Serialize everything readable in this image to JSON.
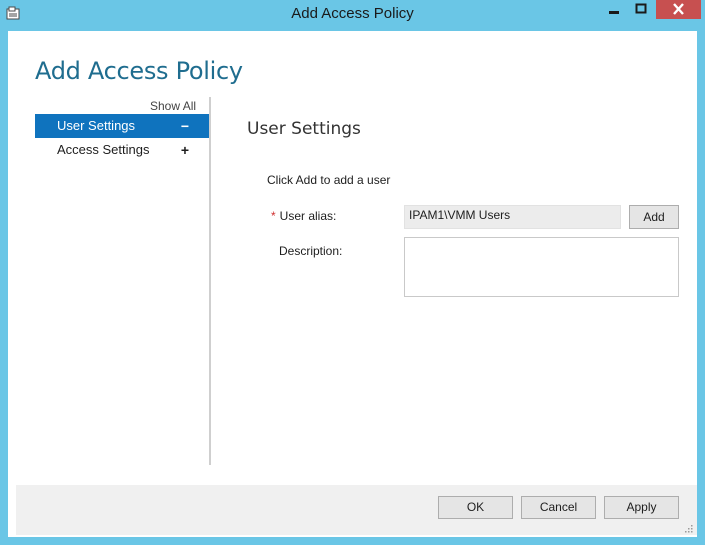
{
  "window": {
    "title": "Add Access Policy",
    "colors": {
      "frame": "#6ac6e6",
      "close": "#c75050",
      "accent": "#0f73be"
    }
  },
  "dialog": {
    "heading": "Add Access Policy"
  },
  "nav": {
    "show_all": "Show All",
    "items": [
      {
        "label": "User Settings",
        "sign": "−",
        "active": true
      },
      {
        "label": "Access Settings",
        "sign": "+",
        "active": false
      }
    ]
  },
  "section": {
    "title": "User Settings",
    "hint": "Click Add to add a user",
    "user_alias_label": "User alias:",
    "required_mark": "*",
    "user_alias_value": "IPAM1\\VMM Users",
    "add_label": "Add",
    "description_label": "Description:",
    "description_value": ""
  },
  "footer": {
    "ok_label": "OK",
    "cancel_label": "Cancel",
    "apply_label": "Apply"
  }
}
